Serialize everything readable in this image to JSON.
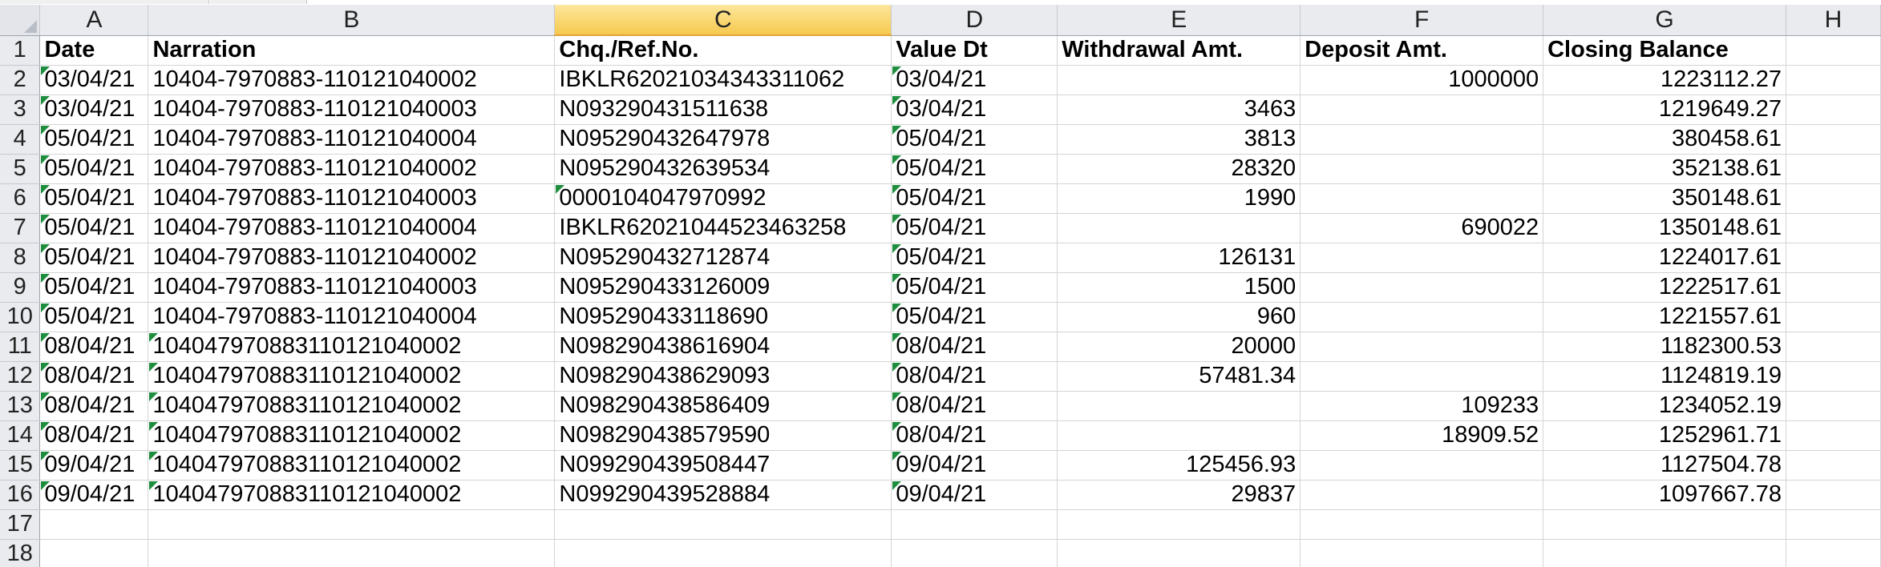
{
  "columns": [
    "A",
    "B",
    "C",
    "D",
    "E",
    "F",
    "G",
    "H"
  ],
  "selected_column": "C",
  "header_row": {
    "number": "1",
    "cells": [
      "Date",
      "Narration",
      "Chq./Ref.No.",
      "Value Dt",
      "Withdrawal Amt.",
      "Deposit Amt.",
      "Closing Balance",
      ""
    ]
  },
  "rows": [
    {
      "number": "2",
      "date": "03/04/21",
      "narration": "10404-7970883-110121040002",
      "ref": "IBKLR62021034343311062",
      "value_dt": "03/04/21",
      "withdrawal": "",
      "deposit": "1000000",
      "balance": "1223112.27"
    },
    {
      "number": "3",
      "date": "03/04/21",
      "narration": "10404-7970883-110121040003",
      "ref": "N093290431511638",
      "value_dt": "03/04/21",
      "withdrawal": "3463",
      "deposit": "",
      "balance": "1219649.27"
    },
    {
      "number": "4",
      "date": "05/04/21",
      "narration": "10404-7970883-110121040004",
      "ref": "N095290432647978",
      "value_dt": "05/04/21",
      "withdrawal": "3813",
      "deposit": "",
      "balance": "380458.61"
    },
    {
      "number": "5",
      "date": "05/04/21",
      "narration": "10404-7970883-110121040002",
      "ref": "N095290432639534",
      "value_dt": "05/04/21",
      "withdrawal": "28320",
      "deposit": "",
      "balance": "352138.61"
    },
    {
      "number": "6",
      "date": "05/04/21",
      "narration": "10404-7970883-110121040003",
      "ref": "0000104047970992",
      "value_dt": "05/04/21",
      "withdrawal": "1990",
      "deposit": "",
      "balance": "350148.61",
      "ref_flag": true
    },
    {
      "number": "7",
      "date": "05/04/21",
      "narration": "10404-7970883-110121040004",
      "ref": "IBKLR62021044523463258",
      "value_dt": "05/04/21",
      "withdrawal": "",
      "deposit": "690022",
      "balance": "1350148.61"
    },
    {
      "number": "8",
      "date": "05/04/21",
      "narration": "10404-7970883-110121040002",
      "ref": "N095290432712874",
      "value_dt": "05/04/21",
      "withdrawal": "126131",
      "deposit": "",
      "balance": "1224017.61"
    },
    {
      "number": "9",
      "date": "05/04/21",
      "narration": "10404-7970883-110121040003",
      "ref": "N095290433126009",
      "value_dt": "05/04/21",
      "withdrawal": "1500",
      "deposit": "",
      "balance": "1222517.61"
    },
    {
      "number": "10",
      "date": "05/04/21",
      "narration": "10404-7970883-110121040004",
      "ref": "N095290433118690",
      "value_dt": "05/04/21",
      "withdrawal": "960",
      "deposit": "",
      "balance": "1221557.61"
    },
    {
      "number": "11",
      "date": "08/04/21",
      "narration": "104047970883110121040002",
      "ref": "N098290438616904",
      "value_dt": "08/04/21",
      "withdrawal": "20000",
      "deposit": "",
      "balance": "1182300.53",
      "narr_flag": true
    },
    {
      "number": "12",
      "date": "08/04/21",
      "narration": "104047970883110121040002",
      "ref": "N098290438629093",
      "value_dt": "08/04/21",
      "withdrawal": "57481.34",
      "deposit": "",
      "balance": "1124819.19",
      "narr_flag": true
    },
    {
      "number": "13",
      "date": "08/04/21",
      "narration": "104047970883110121040002",
      "ref": "N098290438586409",
      "value_dt": "08/04/21",
      "withdrawal": "",
      "deposit": "109233",
      "balance": "1234052.19",
      "narr_flag": true
    },
    {
      "number": "14",
      "date": "08/04/21",
      "narration": "104047970883110121040002",
      "ref": "N098290438579590",
      "value_dt": "08/04/21",
      "withdrawal": "",
      "deposit": "18909.52",
      "balance": "1252961.71",
      "narr_flag": true
    },
    {
      "number": "15",
      "date": "09/04/21",
      "narration": "104047970883110121040002",
      "ref": "N099290439508447",
      "value_dt": "09/04/21",
      "withdrawal": "125456.93",
      "deposit": "",
      "balance": "1127504.78",
      "narr_flag": true
    },
    {
      "number": "16",
      "date": "09/04/21",
      "narration": "104047970883110121040002",
      "ref": "N099290439528884",
      "value_dt": "09/04/21",
      "withdrawal": "29837",
      "deposit": "",
      "balance": "1097667.78",
      "narr_flag": true
    }
  ],
  "empty_rows": [
    "17",
    "18"
  ],
  "colors": {
    "selected_header": "#f6c94f",
    "error_flag": "#1e8e3e",
    "gridline": "#d4d4d4",
    "header_bg": "#e9ebef"
  }
}
